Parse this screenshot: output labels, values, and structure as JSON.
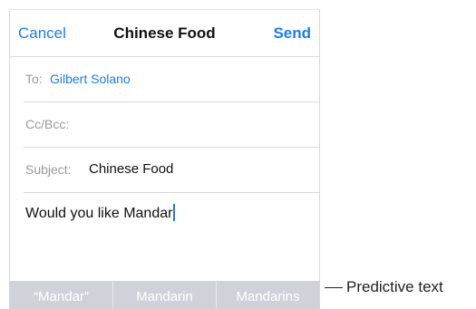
{
  "nav": {
    "cancel_label": "Cancel",
    "title": "Chinese Food",
    "send_label": "Send"
  },
  "fields": {
    "to_label": "To:",
    "to_value": "Gilbert Solano",
    "cc_label": "Cc/Bcc:",
    "subject_label": "Subject:",
    "subject_value": "Chinese Food"
  },
  "body": {
    "text": "Would you like Mandar"
  },
  "predictive": {
    "items": [
      "“Mandar”",
      "Mandarin",
      "Mandarins"
    ]
  },
  "callout": {
    "label": "Predictive text"
  },
  "colors": {
    "accent": "#1a7ee6",
    "predictive_bar": "#cfd3d9",
    "caret": "#2f74d6"
  }
}
